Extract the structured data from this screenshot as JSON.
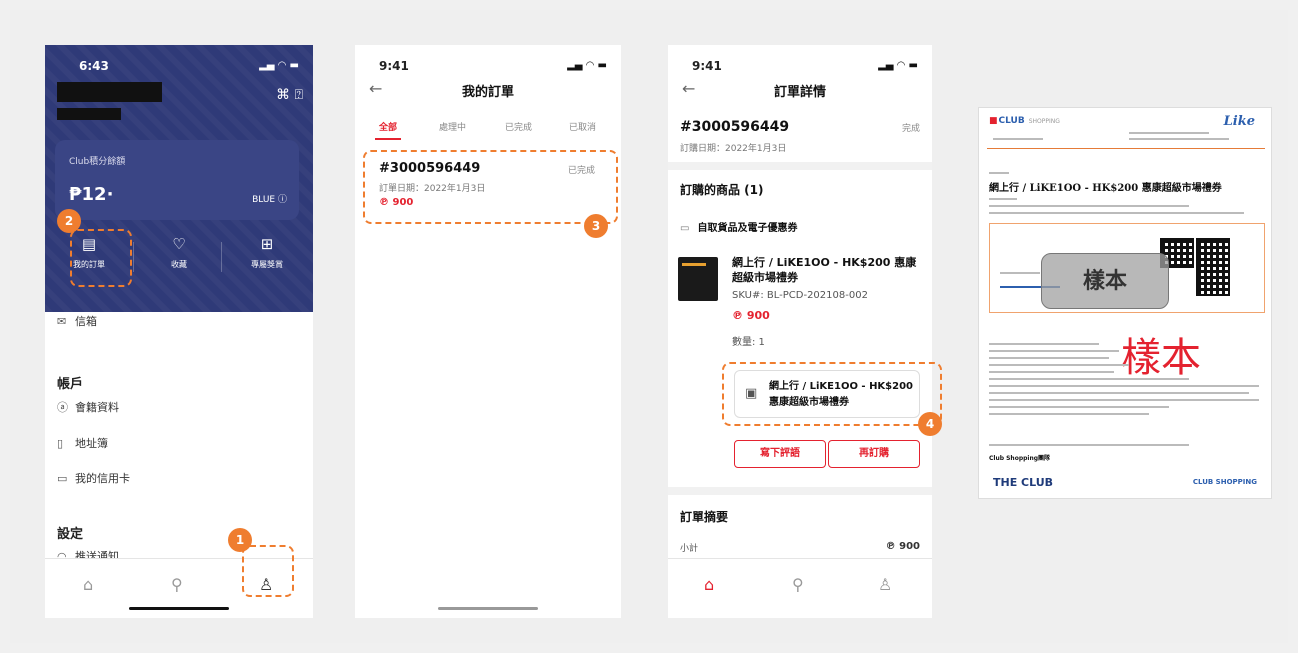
{
  "phone1": {
    "time": "6:43",
    "points_label": "Club積分餘額",
    "points_value": "12",
    "tier": "BLUE ⓘ",
    "quick_nav": [
      "我的訂單",
      "收藏",
      "專屬獎賞"
    ],
    "inbox": "信箱",
    "account_heading": "帳戶",
    "account_items": [
      "會籍資料",
      "地址簿",
      "我的信用卡"
    ],
    "settings_heading": "設定",
    "settings_item": "推送通知"
  },
  "phone2": {
    "time": "9:41",
    "title": "我的訂單",
    "tabs": [
      "全部",
      "處理中",
      "已完成",
      "已取消"
    ],
    "order": {
      "number": "#3000596449",
      "status": "已完成",
      "date": "訂單日期：2022年1月3日",
      "price": "900"
    }
  },
  "phone3": {
    "time": "9:41",
    "title": "訂單詳情",
    "order_number": "#3000596449",
    "status": "完成",
    "date": "訂購日期：2022年1月3日",
    "items_heading": "訂購的商品 (1)",
    "delivery_type": "自取貨品及電子優惠券",
    "product_name": "網上行 / LiKE1OO - HK$200 惠康超級市場禮券",
    "sku": "SKU#:  BL-PCD-202108-002",
    "price": "900",
    "quantity": "數量: 1",
    "voucher_label": "網上行 / LiKE1OO - HK$200 惠康超級市場禮券",
    "review_button": "寫下評語",
    "reorder_button": "再訂購",
    "summary_heading": "訂單摘要",
    "subtotal_label": "小計",
    "subtotal_value": "900"
  },
  "document": {
    "club_logo": "CLUB",
    "club_logo_sub": "SHOPPING",
    "like_logo": "Like",
    "title": "網上行 / LiKE1OO - HK$200 惠康超級市場禮券",
    "watermark_box": "樣本",
    "watermark_red": "樣本",
    "signoff": "Club Shopping團隊",
    "footer_logo": "THE CLUB",
    "footer_small": "CLUB SHOPPING"
  },
  "badges": [
    "1",
    "2",
    "3",
    "4"
  ],
  "colors": {
    "navy": "#2f3a78",
    "accent_red": "#e4222f",
    "annotation_orange": "#ef7d2f"
  }
}
